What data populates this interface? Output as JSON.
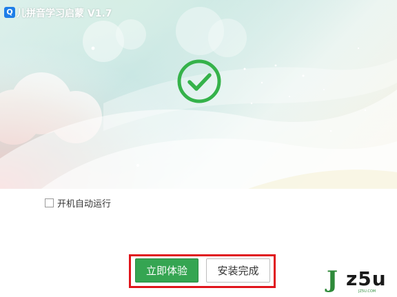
{
  "window": {
    "title": "儿拼音学习启蒙 V1.7",
    "app_icon_glyph": "Q"
  },
  "hero": {
    "status_icon": "check-circle-icon",
    "accent_color": "#35b24a"
  },
  "options": {
    "autorun_label": "开机自动运行",
    "autorun_checked": false
  },
  "actions": {
    "primary_label": "立即体验",
    "secondary_label": "安装完成",
    "highlight_color": "#e0141b"
  },
  "watermark": {
    "text": "z5u",
    "j": "J",
    "sub": "JZ5U.COM"
  }
}
